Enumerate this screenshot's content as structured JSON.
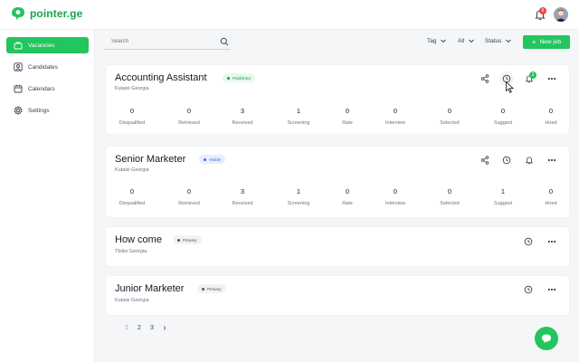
{
  "app": {
    "brand": "pointer.ge",
    "notifications_count": "6"
  },
  "colors": {
    "accent": "#22c55e",
    "published": "#16a34a",
    "visible": "#3b6be0"
  },
  "sidebar": {
    "items": [
      {
        "label": "Vacancies",
        "icon": "briefcase-icon",
        "active": true
      },
      {
        "label": "Candidates",
        "icon": "users-icon",
        "active": false
      },
      {
        "label": "Calendars",
        "icon": "calendar-icon",
        "active": false
      },
      {
        "label": "Settings",
        "icon": "gear-icon",
        "active": false
      }
    ]
  },
  "toolbar": {
    "search_placeholder": "Search",
    "filters": [
      "Tag",
      "All",
      "Status"
    ],
    "new_job_label": "New job"
  },
  "stat_labels": [
    "Disqualified",
    "Retrieved",
    "Received",
    "Screening",
    "Rate",
    "Interview",
    "Selected",
    "Suggest",
    "Hired"
  ],
  "jobs": [
    {
      "title": "Accounting Assistant",
      "location": "Kutaisi Georgia",
      "tag": "Published",
      "notif_badge": "2",
      "stats": [
        "0",
        "0",
        "3",
        "1",
        "0",
        "0",
        "0",
        "0",
        "0"
      ]
    },
    {
      "title": "Senior Marketer",
      "location": "Kutaisi Georgia",
      "tag": "Visible",
      "stats": [
        "0",
        "0",
        "3",
        "1",
        "0",
        "0",
        "0",
        "1",
        "0"
      ]
    },
    {
      "title": "How come",
      "location": "Tbilisi Georgia",
      "tag": "Primary"
    },
    {
      "title": "Junior Marketer",
      "location": "Kutaisi Georgia",
      "tag": "Primary"
    }
  ],
  "pagination": {
    "pages": [
      "1",
      "2",
      "3"
    ],
    "next": "›"
  }
}
